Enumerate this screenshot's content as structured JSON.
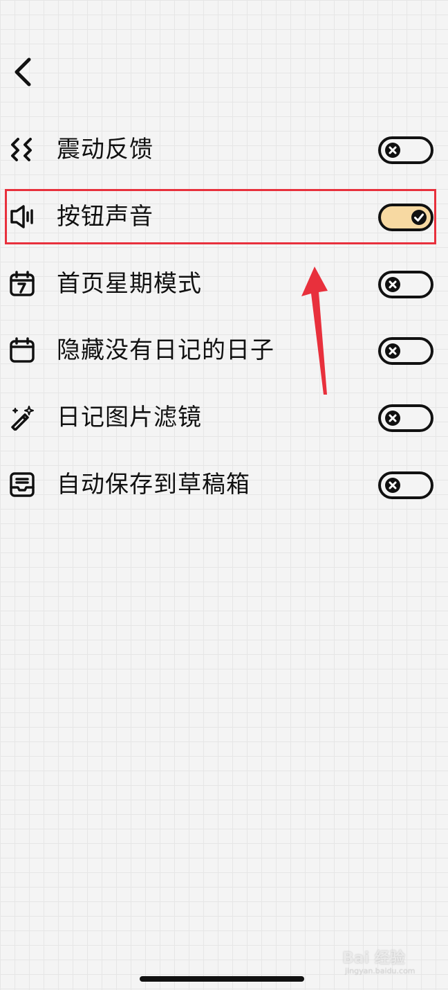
{
  "settings": [
    {
      "label": "震动反馈",
      "icon": "vibration-icon",
      "enabled": false
    },
    {
      "label": "按钮声音",
      "icon": "speaker-icon",
      "enabled": true
    },
    {
      "label": "首页星期模式",
      "icon": "calendar-week-icon",
      "enabled": false
    },
    {
      "label": "隐藏没有日记的日子",
      "icon": "calendar-icon",
      "enabled": false
    },
    {
      "label": "日记图片滤镜",
      "icon": "magic-wand-icon",
      "enabled": false
    },
    {
      "label": "自动保存到草稿箱",
      "icon": "inbox-tray-icon",
      "enabled": false
    }
  ],
  "colors": {
    "toggle_on": "#f7d9a2",
    "highlight": "#e8303c",
    "icon": "#111111"
  },
  "watermark": {
    "text": "Bai 经验",
    "sub": "jingyan.baidu.com"
  }
}
